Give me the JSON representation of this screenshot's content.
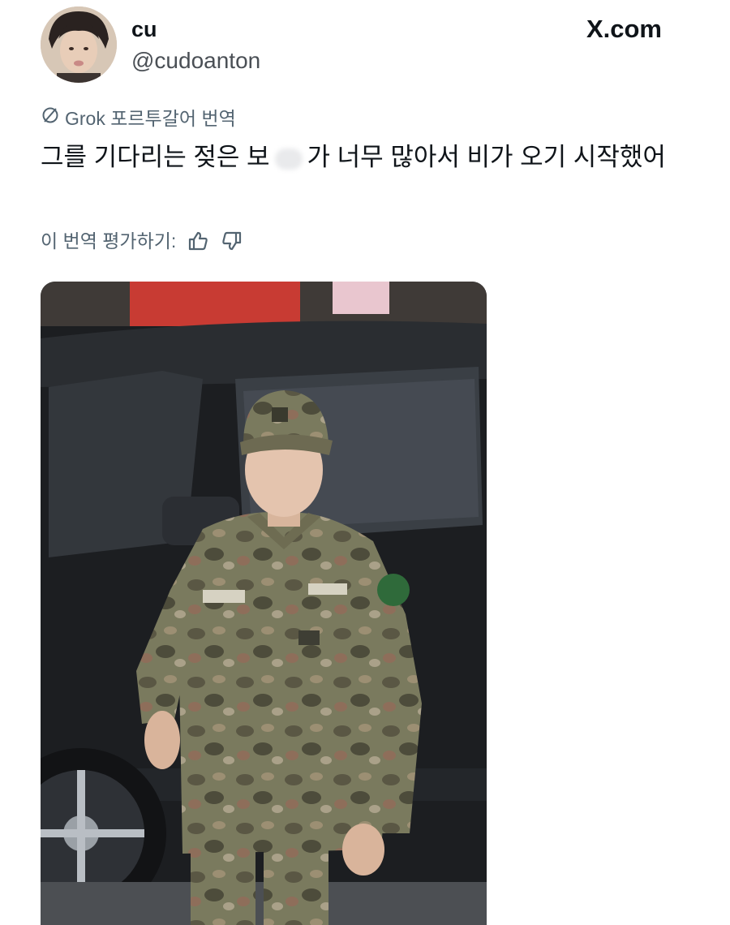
{
  "post": {
    "display_name": "cu",
    "handle": "@cudoanton",
    "brand": "X.com",
    "translation_label": "Grok 포르투갈어 번역",
    "text_before": "그를 기다리는 젖은 보",
    "text_after": "가 너무 많아서 비가 오기 시작했어",
    "rate_label": "이 번역 평가하기:"
  },
  "icons": {
    "translation": "no-translate-icon",
    "like": "thumbs-up-icon",
    "dislike": "thumbs-down-icon"
  },
  "colors": {
    "text": "#0f1419",
    "secondary": "#536471"
  }
}
